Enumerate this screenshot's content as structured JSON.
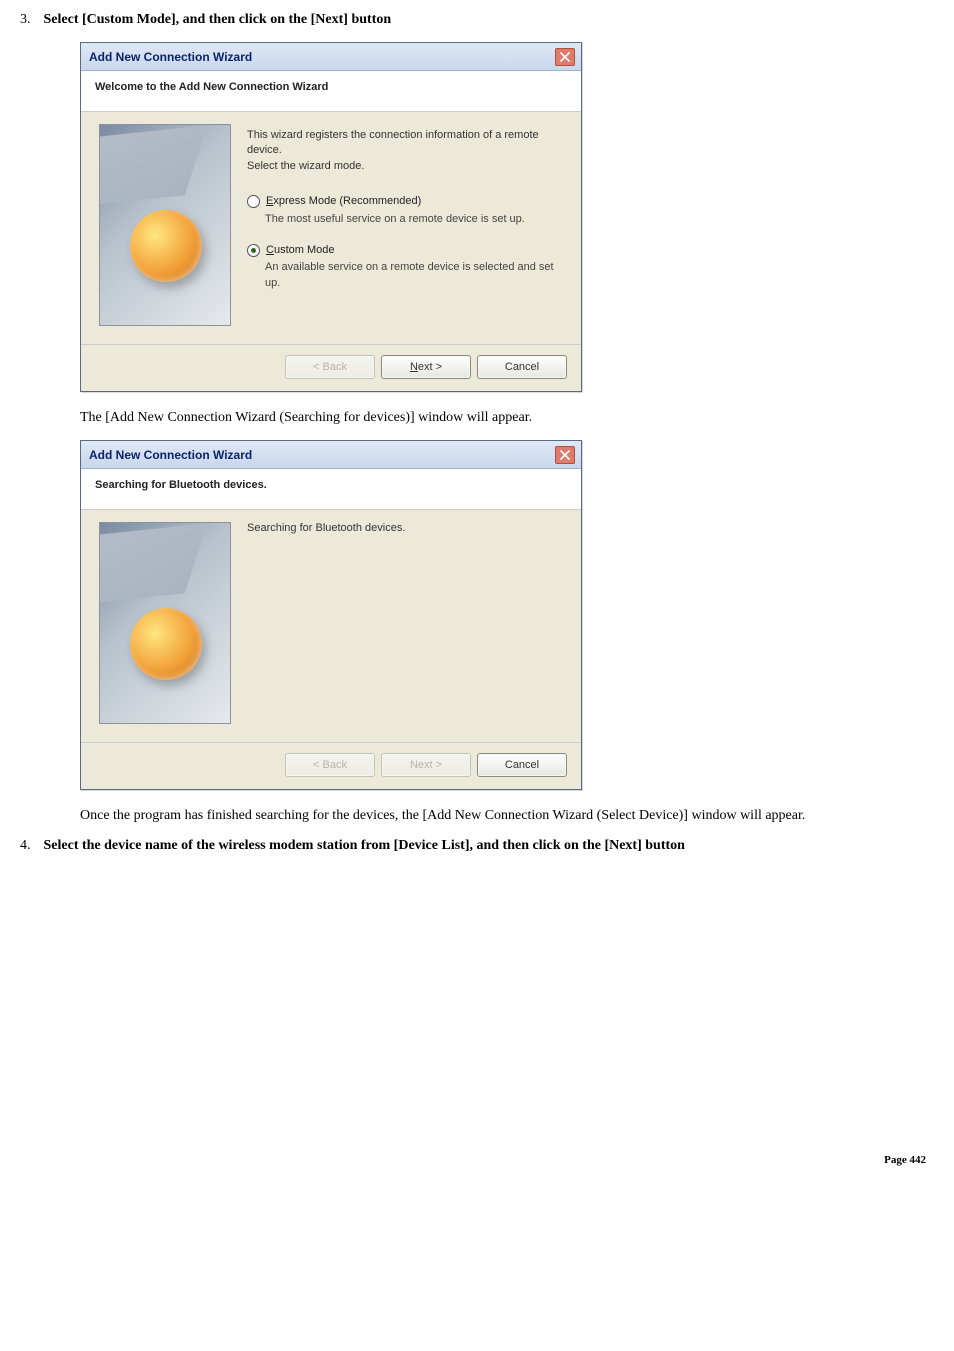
{
  "steps": {
    "s3": {
      "num": "3.",
      "text": "Select [Custom Mode], and then click on the [Next] button"
    },
    "s4": {
      "num": "4.",
      "text": "Select the device name of the wireless modem station from [Device List], and then click on the [Next] button"
    }
  },
  "paragraphs": {
    "p1": "The [Add New Connection Wizard (Searching for devices)] window will appear.",
    "p2": "Once the program has finished searching for the devices, the [Add New Connection Wizard (Select Device)] window will appear."
  },
  "wizard1": {
    "title": "Add New Connection Wizard",
    "subheader": "Welcome to the Add New Connection Wizard",
    "intro1": "This wizard registers the connection information of a remote device.",
    "intro2": "Select the wizard mode.",
    "opt_express_pre": "E",
    "opt_express_post": "xpress Mode (Recommended)",
    "opt_express_desc": "The most useful service on a remote device is set up.",
    "opt_custom_pre": "C",
    "opt_custom_post": "ustom Mode",
    "opt_custom_desc": "An available service on a remote device is selected and set up.",
    "back": "< Back",
    "next_pre": "N",
    "next_post": "ext >",
    "cancel": "Cancel"
  },
  "wizard2": {
    "title": "Add New Connection Wizard",
    "subheader": "Searching for Bluetooth devices.",
    "msg": "Searching for Bluetooth devices.",
    "back": "< Back",
    "next": "Next >",
    "cancel": "Cancel"
  },
  "footer": "Page 442"
}
